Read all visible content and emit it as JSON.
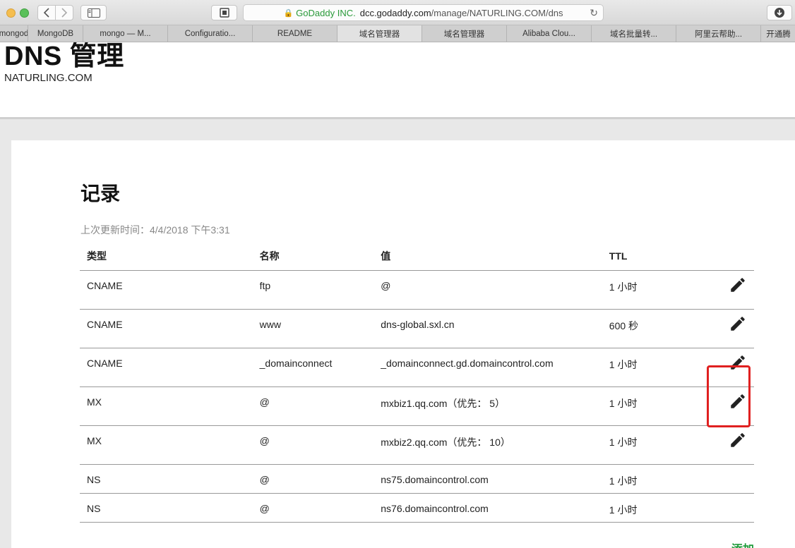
{
  "browser": {
    "url_org": "GoDaddy INC.",
    "url_host": "dcc.godaddy.com",
    "url_path": "/manage/NATURLING.COM/dns",
    "tabs": [
      {
        "label": "mongod",
        "width": 40
      },
      {
        "label": "MongoDB",
        "width": 78
      },
      {
        "label": "mongo — M...",
        "width": 120
      },
      {
        "label": "Configuratio...",
        "width": 120
      },
      {
        "label": "README",
        "width": 120
      },
      {
        "label": "域名管理器",
        "width": 120,
        "active": true
      },
      {
        "label": "域名管理器",
        "width": 120
      },
      {
        "label": "Alibaba Clou...",
        "width": 120
      },
      {
        "label": "域名批量转...",
        "width": 120
      },
      {
        "label": "阿里云帮助...",
        "width": 120
      },
      {
        "label": "开通腾",
        "width": 50
      }
    ]
  },
  "header": {
    "title": "DNS 管理",
    "domain": "NATURLING.COM"
  },
  "records": {
    "title": "记录",
    "last_updated": "上次更新时间：4/4/2018 下午3:31",
    "columns": {
      "type": "类型",
      "name": "名称",
      "value": "值",
      "ttl": "TTL"
    },
    "rows": [
      {
        "type": "CNAME",
        "name": "ftp",
        "value": "@",
        "ttl": "1 小时",
        "editable": true
      },
      {
        "type": "CNAME",
        "name": "www",
        "value": "dns-global.sxl.cn",
        "ttl": "600 秒",
        "editable": true
      },
      {
        "type": "CNAME",
        "name": "_domainconnect",
        "value": "_domainconnect.gd.domaincontrol.com",
        "ttl": "1 小时",
        "editable": true
      },
      {
        "type": "MX",
        "name": "@",
        "value": "mxbiz1.qq.com（优先： 5）",
        "ttl": "1 小时",
        "editable": true
      },
      {
        "type": "MX",
        "name": "@",
        "value": "mxbiz2.qq.com（优先： 10）",
        "ttl": "1 小时",
        "editable": true
      },
      {
        "type": "NS",
        "name": "@",
        "value": "ns75.domaincontrol.com",
        "ttl": "1 小时",
        "editable": false
      },
      {
        "type": "NS",
        "name": "@",
        "value": "ns76.domaincontrol.com",
        "ttl": "1 小时",
        "editable": false
      }
    ],
    "add_label": "添加"
  },
  "colors": {
    "accent_green": "#1e9b3a",
    "highlight_red": "#e02020"
  },
  "icons": {
    "edit": "pencil-icon",
    "lock": "lock-icon",
    "reload": "reload-icon",
    "download": "download-icon"
  }
}
